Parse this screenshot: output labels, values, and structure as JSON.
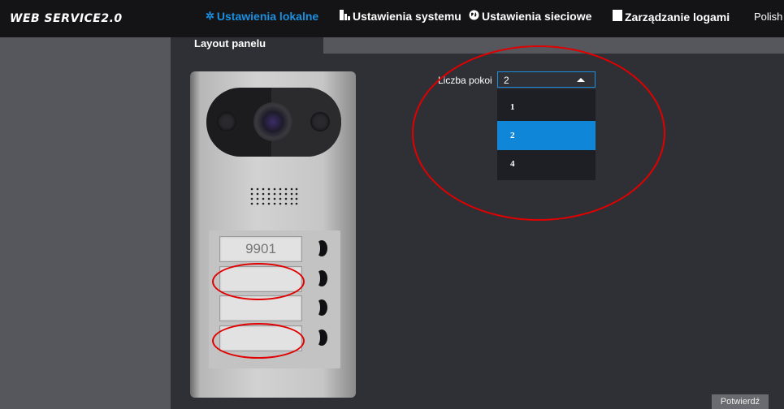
{
  "header": {
    "logo": "WEB SERVICE2.0",
    "nav": [
      {
        "label": "Ustawienia lokalne",
        "icon": "gear-icon",
        "active": true
      },
      {
        "label": "Ustawienia systemu",
        "icon": "system-icon",
        "active": false
      },
      {
        "label": "Ustawienia sieciowe",
        "icon": "globe-icon",
        "active": false
      },
      {
        "label": "Zarządzanie logami",
        "icon": "log-icon",
        "active": false
      }
    ],
    "language": "Polish"
  },
  "tabs": [
    {
      "label": "Layout panelu",
      "active": true
    }
  ],
  "panel_preview": {
    "slots": [
      {
        "label": "9901"
      },
      {
        "label": ""
      },
      {
        "label": ""
      },
      {
        "label": ""
      }
    ]
  },
  "form": {
    "room_count_label": "Liczba pokoi",
    "room_count_value": "2",
    "options": [
      "1",
      "2",
      "4"
    ],
    "selected_option": "2"
  },
  "footer": {
    "confirm_label": "Potwierdź"
  },
  "colors": {
    "accent": "#1a8fe0",
    "annotation": "#e00000",
    "selected_option_bg": "#0f86d8"
  }
}
